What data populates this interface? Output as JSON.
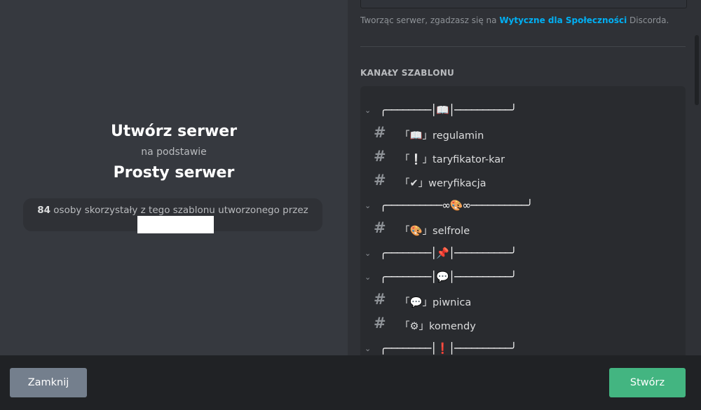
{
  "intro": {
    "title": "Utwórz serwer",
    "subtitle": "na podstawie",
    "template_name": "Prosty serwer",
    "usage_count": "84",
    "usage_text": "osoby skorzystały z tego szablonu utworzonego przez"
  },
  "agreement": {
    "prefix": "Tworząc serwer, zgadzasz się na",
    "link": "Wytyczne dla Społeczności",
    "suffix": "Discorda."
  },
  "channels_section": {
    "label": "KANAŁY SZABLONU",
    "items": [
      {
        "type": "category",
        "name": "╭────────│📖│──────────╯"
      },
      {
        "type": "channel",
        "name": "「📖」regulamin"
      },
      {
        "type": "channel",
        "name": "「❕」taryfikator-kar"
      },
      {
        "type": "channel",
        "name": "「✔」weryfikacja"
      },
      {
        "type": "category",
        "name": "╭──────────∞🎨∞──────────╯"
      },
      {
        "type": "channel",
        "name": "「🎨」selfrole"
      },
      {
        "type": "category",
        "name": "╭────────│📌│──────────╯"
      },
      {
        "type": "category",
        "name": "╭────────│💬│──────────╯"
      },
      {
        "type": "channel",
        "name": "「💬」piwnica"
      },
      {
        "type": "channel",
        "name": "「⚙」komendy"
      },
      {
        "type": "category",
        "name": "╭────────│❗│──────────╯"
      }
    ]
  },
  "footer": {
    "close_label": "Zamknij",
    "create_label": "Stwórz"
  },
  "colors": {
    "background": "#36393f",
    "panel": "#2f3136",
    "footer": "#202225",
    "link": "#00b0f4",
    "primary_button": "#43b581",
    "secondary_button": "#747f8d"
  }
}
